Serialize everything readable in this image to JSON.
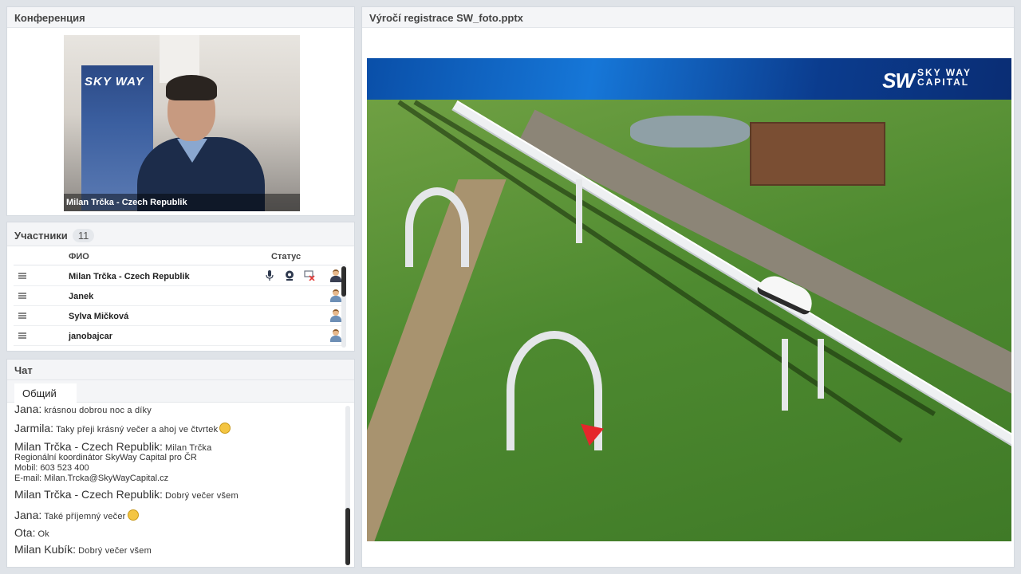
{
  "conference": {
    "title": "Конференция",
    "video_caption": "Milan Trčka - Czech Republik",
    "poster_text": "SKY WAY"
  },
  "participants": {
    "title": "Участники",
    "count": "11",
    "columns": {
      "name": "ФИО",
      "status": "Статус"
    },
    "rows": [
      {
        "name": "Milan Trčka - Czech Republik",
        "mic": true,
        "cam": true,
        "share": true,
        "role": "leader"
      },
      {
        "name": "Janek",
        "role": "member"
      },
      {
        "name": "Sylva Mičková",
        "role": "member"
      },
      {
        "name": "janobajcar",
        "role": "member"
      }
    ]
  },
  "chat": {
    "title": "Чат",
    "tab": "Общий",
    "messages": [
      {
        "who": "Jana:",
        "text": "krásnou dobrou noc  a díky"
      },
      {
        "who": "Jarmila:",
        "text": "Taky přeji krásný večer a ahoj ve čtvrtek",
        "emoji": true
      },
      {
        "who": "Milan Trčka - Czech Republik:",
        "text": "Milan Trčka",
        "lines": [
          "Regionální koordinátor SkyWay Capital pro ČR",
          "Mobil:     603 523 400",
          "E-mail:   Milan.Trcka@SkyWayCapital.cz"
        ]
      },
      {
        "who": "Milan Trčka - Czech Republik:",
        "text": "Dobrý večer všem"
      },
      {
        "who": "Jana:",
        "text": "Také příjemný večer",
        "emoji": true
      },
      {
        "who": "Ota:",
        "text": "Ok"
      },
      {
        "who": "Milan Kubík:",
        "text": "Dobrý večer všem"
      }
    ]
  },
  "presentation": {
    "title": "Výročí registrace SW_foto.pptx",
    "logo_mark": "SW",
    "logo_line1": "SKY WAY",
    "logo_line2": "CAPITAL"
  },
  "colors": {
    "panel_header": "#f4f5f7",
    "banner": "#1677d8",
    "cursor": "#e5262b",
    "scroll_thumb": "#2e2e2e"
  }
}
